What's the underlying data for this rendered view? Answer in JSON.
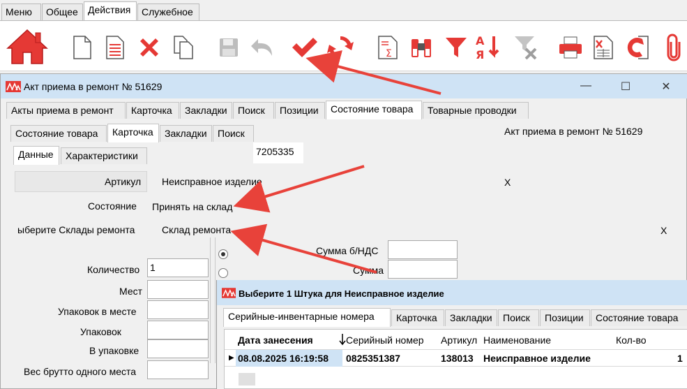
{
  "menu_tabs": [
    "Меню",
    "Общее",
    "Действия",
    "Служебное"
  ],
  "active_menu_tab": "Действия",
  "toolbar_icons": [
    "home-icon",
    "new-doc-icon",
    "doc-list-icon",
    "delete-icon",
    "copy-icon",
    "save-icon",
    "undo-icon",
    "check-icon",
    "refresh-icon",
    "sum-icon",
    "binoculars-icon",
    "filter-icon",
    "sort-az-icon",
    "clear-filter-icon",
    "print-icon",
    "excel-icon",
    "exit-icon",
    "attach-icon"
  ],
  "window1": {
    "title": "Акт приема в ремонт № 51629",
    "controls": {
      "min": "—",
      "max": "☐",
      "close": "✕"
    },
    "tabs": [
      "Акты приема в ремонт",
      "Карточка",
      "Закладки",
      "Поиск",
      "Позиции",
      "Состояние товара",
      "Товарные проводки"
    ],
    "subtabs": [
      "Состояние товара",
      "Карточка",
      "Закладки",
      "Поиск"
    ],
    "header_text": "Акт приема в ремонт № 51629",
    "inner_tabs": [
      "Данные",
      "Характеристики"
    ],
    "code_value": "7205335",
    "fields": {
      "article_label": "Артикул",
      "article_value": "Неисправное изделие",
      "article_clear": "X",
      "state_label": "Состояние",
      "state_value": "Принять на склад",
      "warehouse_label": "ыберите Склады ремонта",
      "warehouse_value": "Склад ремонта",
      "warehouse_clear": "X",
      "sum_vat_label": "Сумма  б/НДС",
      "sum_label": "Сумма",
      "qty_label": "Количество",
      "qty_value": "1",
      "places_label": "Мест",
      "packs_per_place_label": "Упаковок в месте",
      "packs_label": "Упаковок",
      "in_pack_label": "В упаковке",
      "gross_weight_label": "Вес брутто одного места"
    }
  },
  "window2": {
    "title": "Выберите 1 Штука для Неисправное изделие",
    "tabs": [
      "Серийные-инвентарные номера",
      "Карточка",
      "Закладки",
      "Поиск",
      "Позиции",
      "Состояние товара"
    ],
    "columns": [
      "Дата занесения",
      "Серийный номер",
      "Артикул",
      "Наименование",
      "Кол-во"
    ],
    "rows": [
      {
        "date": "08.08.2025 16:19:58",
        "serial": "0825351387",
        "article": "138013",
        "name": "Неисправное изделие",
        "qty": "1"
      }
    ]
  },
  "colors": {
    "accent_red": "#e53935",
    "title_bar": "#cfe3f5",
    "arrow": "#e8423a"
  }
}
